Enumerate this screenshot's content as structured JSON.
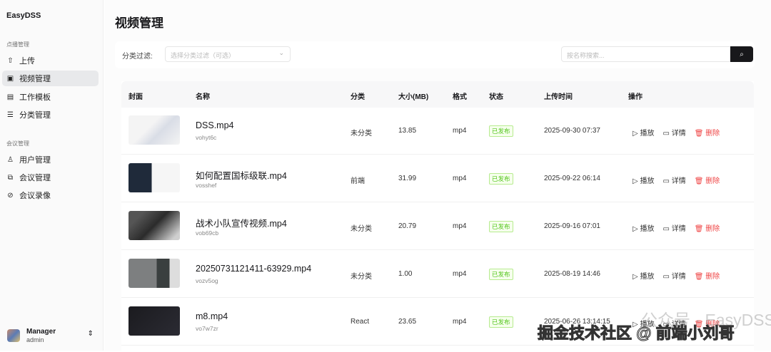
{
  "sidebar": {
    "brand": "EasyDSS",
    "group1": "点播管理",
    "group2": "会议管理",
    "items": [
      {
        "label": "上传",
        "icon": "upload-icon"
      },
      {
        "label": "视频管理",
        "icon": "video-icon"
      },
      {
        "label": "工作模板",
        "icon": "template-icon"
      },
      {
        "label": "分类管理",
        "icon": "list-icon"
      },
      {
        "label": "用户管理",
        "icon": "user-icon"
      },
      {
        "label": "会议管理",
        "icon": "meeting-icon"
      },
      {
        "label": "会议录像",
        "icon": "recording-icon"
      }
    ],
    "user": {
      "name": "Manager",
      "role": "admin"
    }
  },
  "page": {
    "title": "视频管理"
  },
  "filter": {
    "label": "分类过滤:",
    "select_placeholder": "选择分类过滤（可选）",
    "search_placeholder": "按名称搜索..."
  },
  "table": {
    "headers": [
      "封面",
      "名称",
      "分类",
      "大小(MB)",
      "格式",
      "状态",
      "上传时间",
      "操作"
    ],
    "actions": {
      "play": "播放",
      "detail": "详情",
      "delete": "删除"
    },
    "rows": [
      {
        "name": "DSS.mp4",
        "id": "vohyt6c",
        "category": "未分类",
        "size": "13.85",
        "format": "mp4",
        "status": "已发布",
        "time": "2025-09-30 07:37"
      },
      {
        "name": "如何配置国标级联.mp4",
        "id": "vosshef",
        "category": "前端",
        "size": "31.99",
        "format": "mp4",
        "status": "已发布",
        "time": "2025-09-22 06:14"
      },
      {
        "name": "战术小队宣传视频.mp4",
        "id": "vob69cb",
        "category": "未分类",
        "size": "20.79",
        "format": "mp4",
        "status": "已发布",
        "time": "2025-09-16 07:01"
      },
      {
        "name": "20250731121411-63929.mp4",
        "id": "vozv5og",
        "category": "未分类",
        "size": "1.00",
        "format": "mp4",
        "status": "已发布",
        "time": "2025-08-19 14:46"
      },
      {
        "name": "m8.mp4",
        "id": "vo7w7zr",
        "category": "React",
        "size": "23.65",
        "format": "mp4",
        "status": "已发布",
        "time": "2025-06-26 13:14:15"
      }
    ]
  },
  "watermark": {
    "line1": "公众号 · EasyDSS",
    "line2": "掘金技术社区 @ 前端小刘哥"
  },
  "colors": {
    "accent": "#18181b",
    "published": "#52c41a",
    "delete": "#ef4444"
  }
}
